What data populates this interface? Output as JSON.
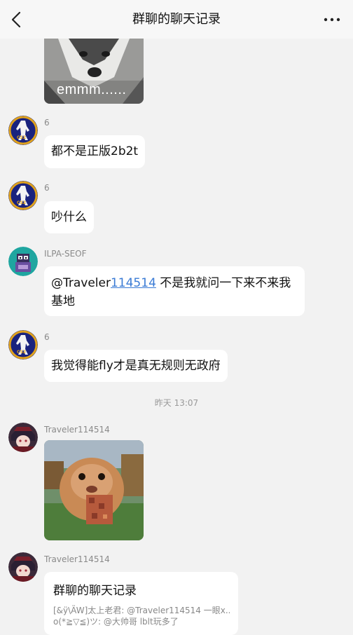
{
  "header": {
    "title": "群聊的聊天记录",
    "back_icon": "chevron-left-icon",
    "more_icon": "more-horizontal-icon"
  },
  "top_image": {
    "caption": "emmm......"
  },
  "messages": [
    {
      "sender": "6",
      "text": "都不是正版2b2t"
    },
    {
      "sender": "6",
      "text": "吵什么"
    },
    {
      "sender": "ILPA-SEOF",
      "mention_prefix": "@Traveler",
      "mention_link": "114514",
      "text_line1": " 不是我就问一下来不来我",
      "text_line2": "基地"
    },
    {
      "sender": "6",
      "text": "我觉得能fly才是真无规则无政府"
    }
  ],
  "timestamp": "昨天 13:07",
  "messages2": [
    {
      "sender": "Traveler114514"
    },
    {
      "sender": "Traveler114514"
    }
  ],
  "forward_card": {
    "title": "群聊的聊天记录",
    "line1": "[&ÿ\\ÄW]太上老君: @Traveler114514 一眼x...",
    "line2": "o(*≧▽≦)ツ: @大帅哥 lblt玩多了"
  },
  "colors": {
    "background": "#f2f2f2",
    "bubble": "#ffffff",
    "link": "#3a7bd5",
    "cs_avatar_bg": "#1a237e",
    "cs_avatar_ring": "#e0a21c"
  }
}
